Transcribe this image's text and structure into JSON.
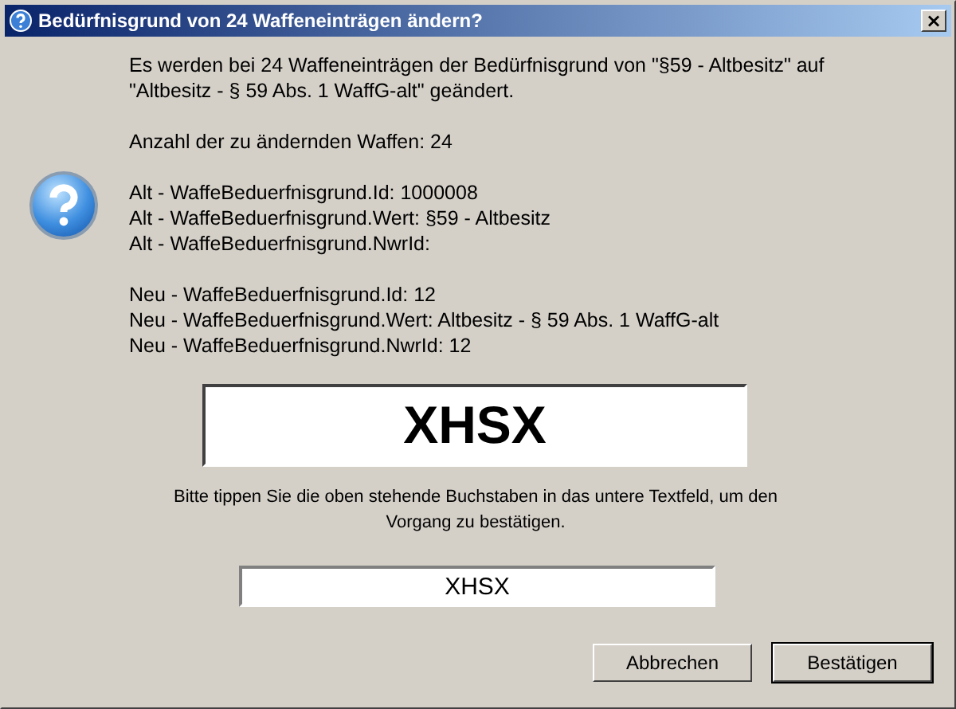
{
  "window": {
    "title": "Bedürfnisgrund von 24 Waffeneinträgen ändern?",
    "close": "×"
  },
  "message": [
    "Es werden bei 24 Waffeneinträgen der Bedürfnisgrund von \"§59 - Altbesitz\" auf \"Altbesitz - § 59 Abs. 1 WaffG-alt\" geändert.",
    "Anzahl der zu ändernden Waffen: 24",
    [
      "Alt - WaffeBeduerfnisgrund.Id: 1000008",
      "Alt - WaffeBeduerfnisgrund.Wert: §59 - Altbesitz",
      "Alt - WaffeBeduerfnisgrund.NwrId:"
    ],
    [
      "Neu - WaffeBeduerfnisgrund.Id: 12",
      "Neu - WaffeBeduerfnisgrund.Wert: Altbesitz - § 59 Abs. 1 WaffG-alt",
      "Neu - WaffeBeduerfnisgrund.NwrId: 12"
    ]
  ],
  "captcha": "XHSX",
  "instruction": "Bitte tippen Sie die oben stehende Buchstaben in das untere Textfeld, um den Vorgang zu bestätigen.",
  "input": {
    "value": "XHSX"
  },
  "buttons": [
    {
      "label": "Abbrechen",
      "default": false
    },
    {
      "label": "Bestätigen",
      "default": true
    }
  ]
}
